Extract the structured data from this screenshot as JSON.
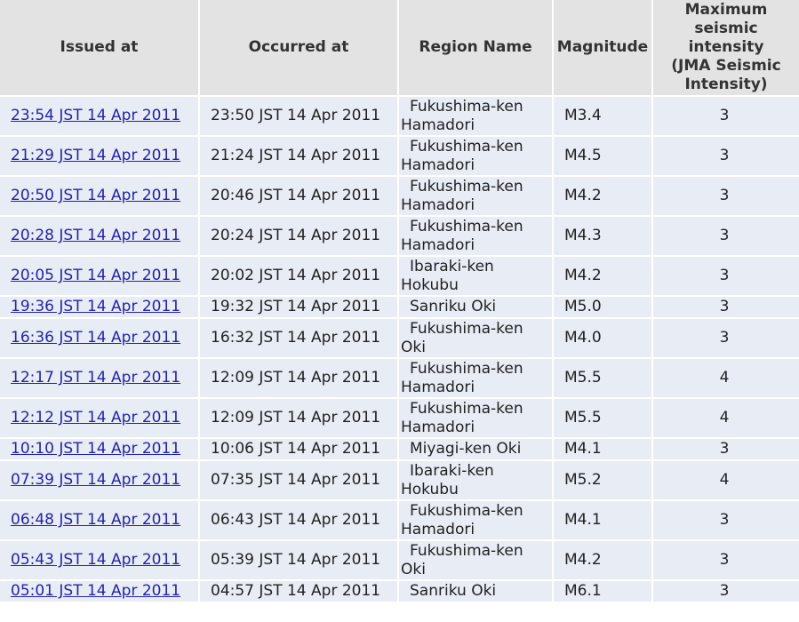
{
  "table": {
    "headers": {
      "issued": "Issued at",
      "occurred": "Occurred at",
      "region": "Region Name",
      "magnitude": "Magnitude",
      "intensity_line1": "Maximum",
      "intensity_line2": "seismic",
      "intensity_line3": "intensity",
      "intensity_line4": "(JMA Seismic",
      "intensity_line5": "Intensity)"
    },
    "rows": [
      {
        "issued": "23:54 JST 14 Apr 2011",
        "occurred": "23:50 JST 14 Apr 2011",
        "region": "Fukushima-ken Hamadori",
        "magnitude": "M3.4",
        "intensity": "3"
      },
      {
        "issued": "21:29 JST 14 Apr 2011",
        "occurred": "21:24 JST 14 Apr 2011",
        "region": "Fukushima-ken Hamadori",
        "magnitude": "M4.5",
        "intensity": "3"
      },
      {
        "issued": "20:50 JST 14 Apr 2011",
        "occurred": "20:46 JST 14 Apr 2011",
        "region": "Fukushima-ken Hamadori",
        "magnitude": "M4.2",
        "intensity": "3"
      },
      {
        "issued": "20:28 JST 14 Apr 2011",
        "occurred": "20:24 JST 14 Apr 2011",
        "region": "Fukushima-ken Hamadori",
        "magnitude": "M4.3",
        "intensity": "3"
      },
      {
        "issued": "20:05 JST 14 Apr 2011",
        "occurred": "20:02 JST 14 Apr 2011",
        "region": "Ibaraki-ken Hokubu",
        "magnitude": "M4.2",
        "intensity": "3"
      },
      {
        "issued": "19:36 JST 14 Apr 2011",
        "occurred": "19:32 JST 14 Apr 2011",
        "region": "Sanriku Oki",
        "magnitude": "M5.0",
        "intensity": "3"
      },
      {
        "issued": "16:36 JST 14 Apr 2011",
        "occurred": "16:32 JST 14 Apr 2011",
        "region": "Fukushima-ken Oki",
        "magnitude": "M4.0",
        "intensity": "3"
      },
      {
        "issued": "12:17 JST 14 Apr 2011",
        "occurred": "12:09 JST 14 Apr 2011",
        "region": "Fukushima-ken Hamadori",
        "magnitude": "M5.5",
        "intensity": "4"
      },
      {
        "issued": "12:12 JST 14 Apr 2011",
        "occurred": "12:09 JST 14 Apr 2011",
        "region": "Fukushima-ken Hamadori",
        "magnitude": "M5.5",
        "intensity": "4"
      },
      {
        "issued": "10:10 JST 14 Apr 2011",
        "occurred": "10:06 JST 14 Apr 2011",
        "region": "Miyagi-ken Oki",
        "magnitude": "M4.1",
        "intensity": "3"
      },
      {
        "issued": "07:39 JST 14 Apr 2011",
        "occurred": "07:35 JST 14 Apr 2011",
        "region": "Ibaraki-ken Hokubu",
        "magnitude": "M5.2",
        "intensity": "4"
      },
      {
        "issued": "06:48 JST 14 Apr 2011",
        "occurred": "06:43 JST 14 Apr 2011",
        "region": "Fukushima-ken Hamadori",
        "magnitude": "M4.1",
        "intensity": "3"
      },
      {
        "issued": "05:43 JST 14 Apr 2011",
        "occurred": "05:39 JST 14 Apr 2011",
        "region": "Fukushima-ken Oki",
        "magnitude": "M4.2",
        "intensity": "3"
      },
      {
        "issued": "05:01 JST 14 Apr 2011",
        "occurred": "04:57 JST 14 Apr 2011",
        "region": "Sanriku Oki",
        "magnitude": "M6.1",
        "intensity": "3"
      }
    ]
  }
}
